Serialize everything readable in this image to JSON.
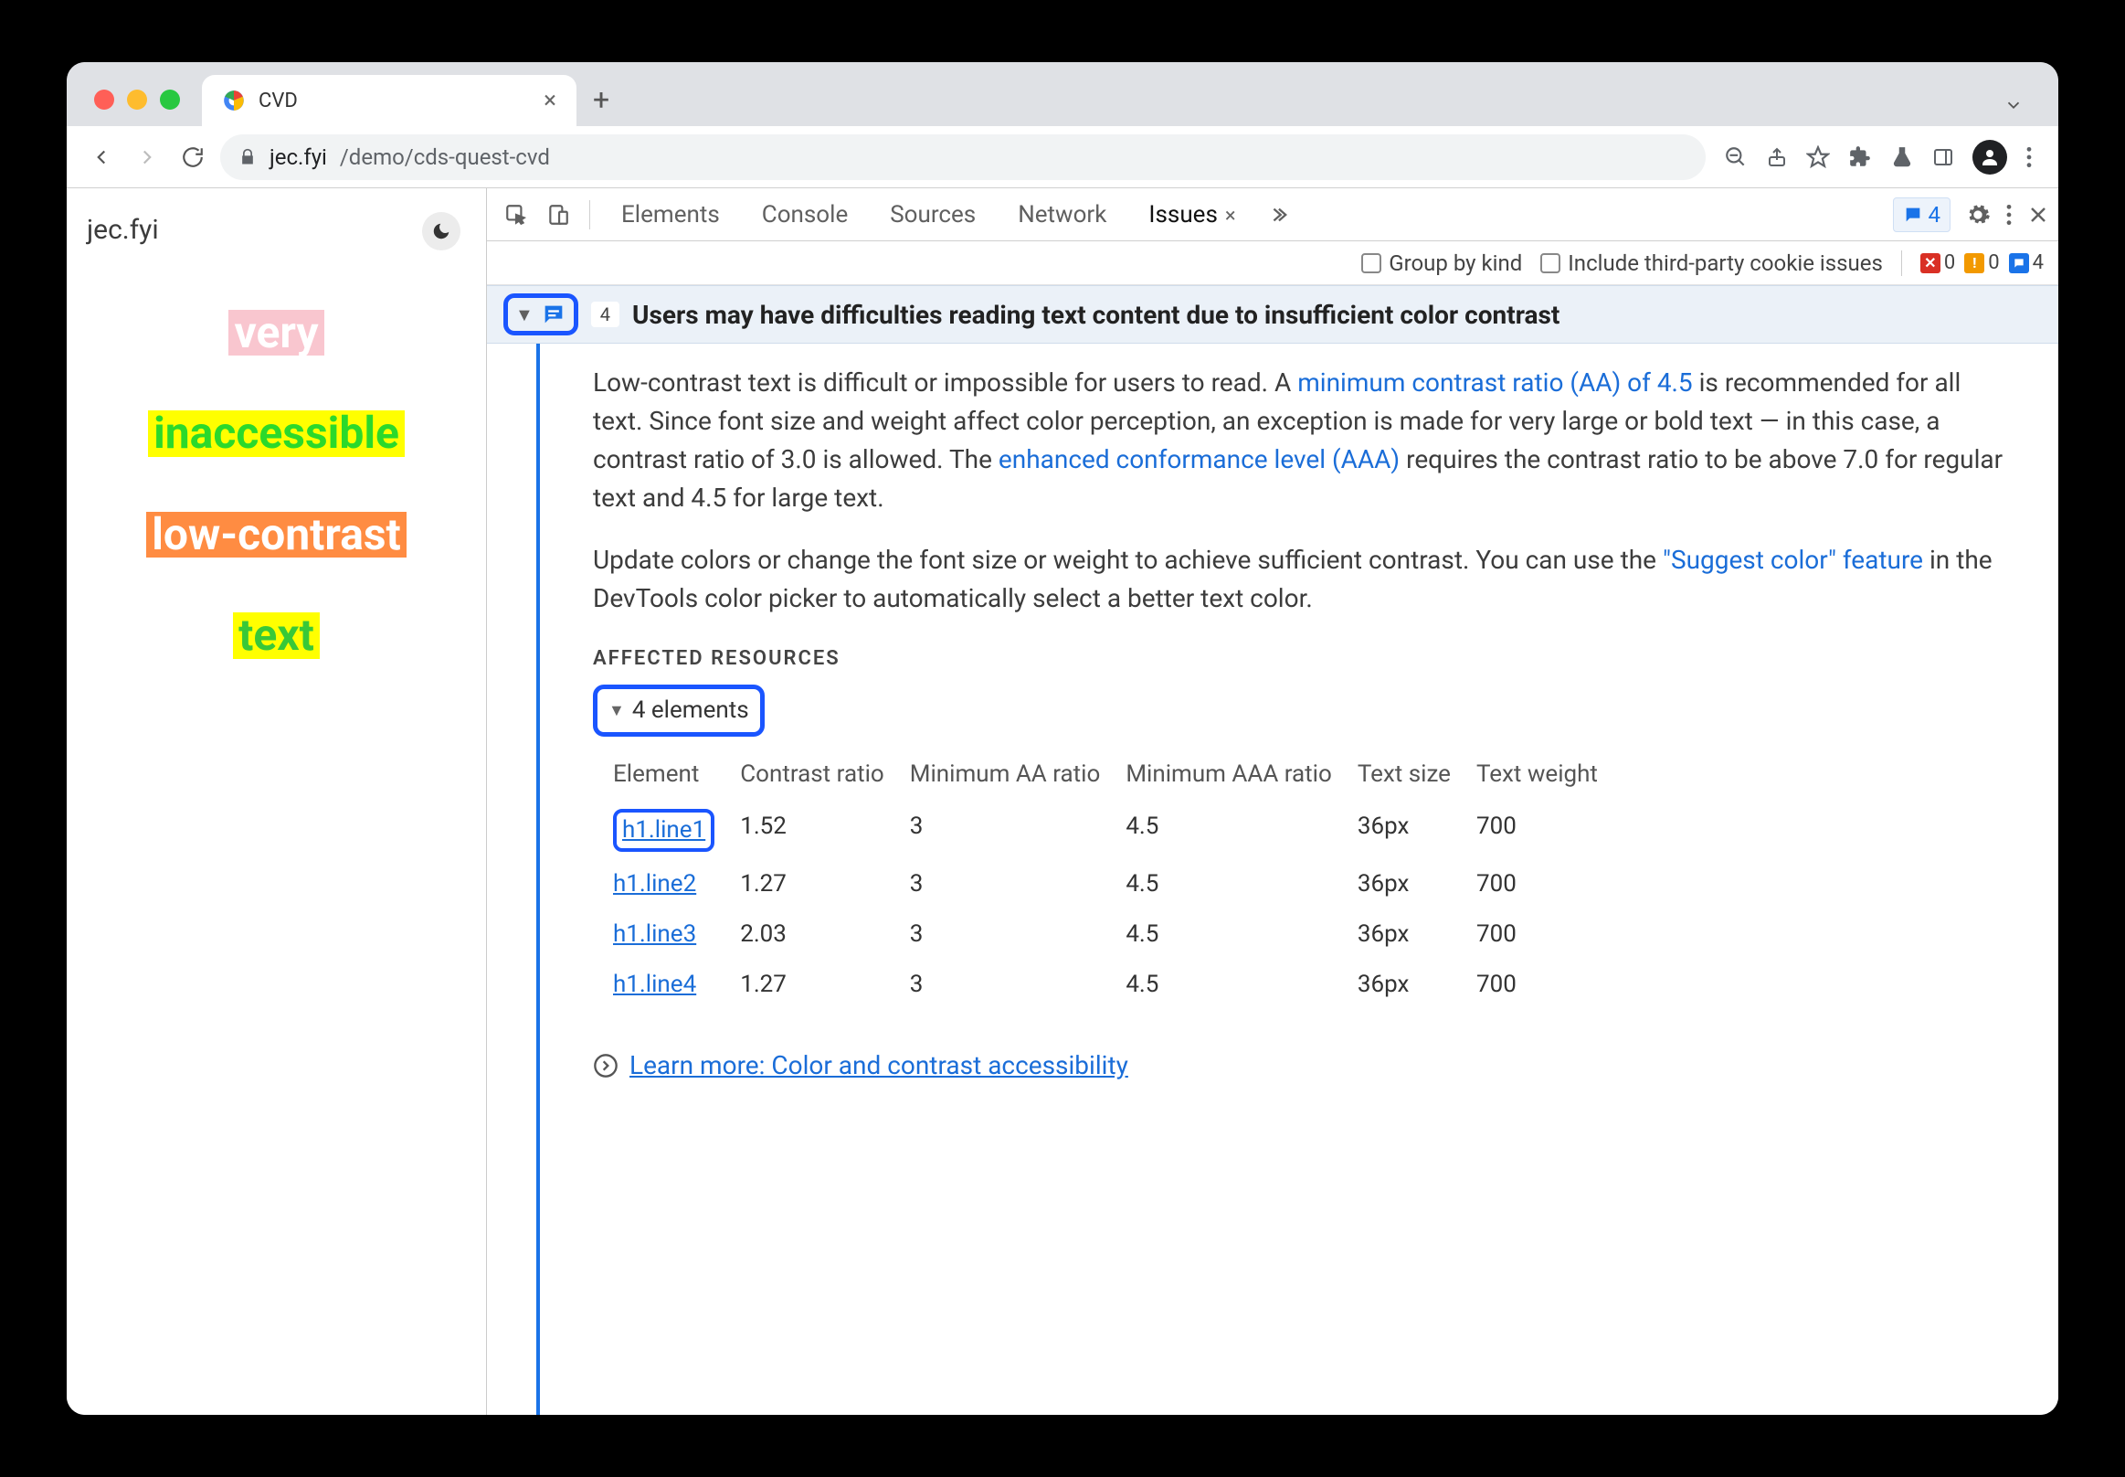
{
  "browser": {
    "tab_title": "CVD",
    "url_host": "jec.fyi",
    "url_path": "/demo/cds-quest-cvd"
  },
  "page": {
    "site_label": "jec.fyi",
    "lines": [
      "very",
      "inaccessible",
      "low-contrast",
      "text"
    ]
  },
  "devtools": {
    "tabs": {
      "elements": "Elements",
      "console": "Console",
      "sources": "Sources",
      "network": "Network",
      "issues": "Issues"
    },
    "badge_count": "4",
    "issues_bar": {
      "group_by_kind": "Group by kind",
      "third_party": "Include third-party cookie issues",
      "counts": {
        "errors": "0",
        "warnings": "0",
        "messages": "4"
      }
    }
  },
  "issue": {
    "count_chip": "4",
    "title": "Users may have difficulties reading text content due to insufficient color contrast",
    "para1_a": "Low-contrast text is difficult or impossible for users to read. A ",
    "link1": "minimum contrast ratio (AA) of 4.5",
    "para1_b": " is recommended for all text. Since font size and weight affect color perception, an exception is made for very large or bold text — in this case, a contrast ratio of 3.0 is allowed. The ",
    "link2": "enhanced conformance level (AAA)",
    "para1_c": " requires the contrast ratio to be above 7.0 for regular text and 4.5 for large text.",
    "para2_a": "Update colors or change the font size or weight to achieve sufficient contrast. You can use the ",
    "link3": "\"Suggest color\" feature",
    "para2_b": " in the DevTools color picker to automatically select a better text color.",
    "affected_resources": "AFFECTED RESOURCES",
    "elements_summary": "4 elements",
    "table": {
      "headers": {
        "element": "Element",
        "contrast": "Contrast ratio",
        "min_aa": "Minimum AA ratio",
        "min_aaa": "Minimum AAA ratio",
        "size": "Text size",
        "weight": "Text weight"
      },
      "rows": [
        {
          "el": "h1.line1",
          "cr": "1.52",
          "aa": "3",
          "aaa": "4.5",
          "size": "36px",
          "w": "700"
        },
        {
          "el": "h1.line2",
          "cr": "1.27",
          "aa": "3",
          "aaa": "4.5",
          "size": "36px",
          "w": "700"
        },
        {
          "el": "h1.line3",
          "cr": "2.03",
          "aa": "3",
          "aaa": "4.5",
          "size": "36px",
          "w": "700"
        },
        {
          "el": "h1.line4",
          "cr": "1.27",
          "aa": "3",
          "aaa": "4.5",
          "size": "36px",
          "w": "700"
        }
      ]
    },
    "learn_more": "Learn more: Color and contrast accessibility"
  }
}
